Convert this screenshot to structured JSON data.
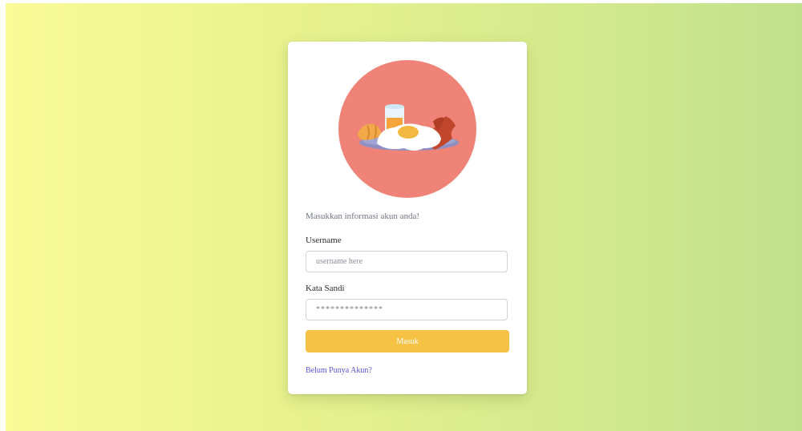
{
  "login": {
    "intro_text": "Masukkan informasi akun anda!",
    "username_label": "Username",
    "username_placeholder": "username here",
    "password_label": "Kata Sandi",
    "password_value": "**************",
    "submit_label": "Masuk",
    "register_link": "Belum Punya Akun?"
  },
  "colors": {
    "background_start": "#f9fb97",
    "background_end": "#c0e18b",
    "hero_circle": "#ef8378",
    "button": "#f5c243",
    "link": "#5a55d6"
  },
  "hero": {
    "icon": "breakfast-plate-illustration"
  }
}
